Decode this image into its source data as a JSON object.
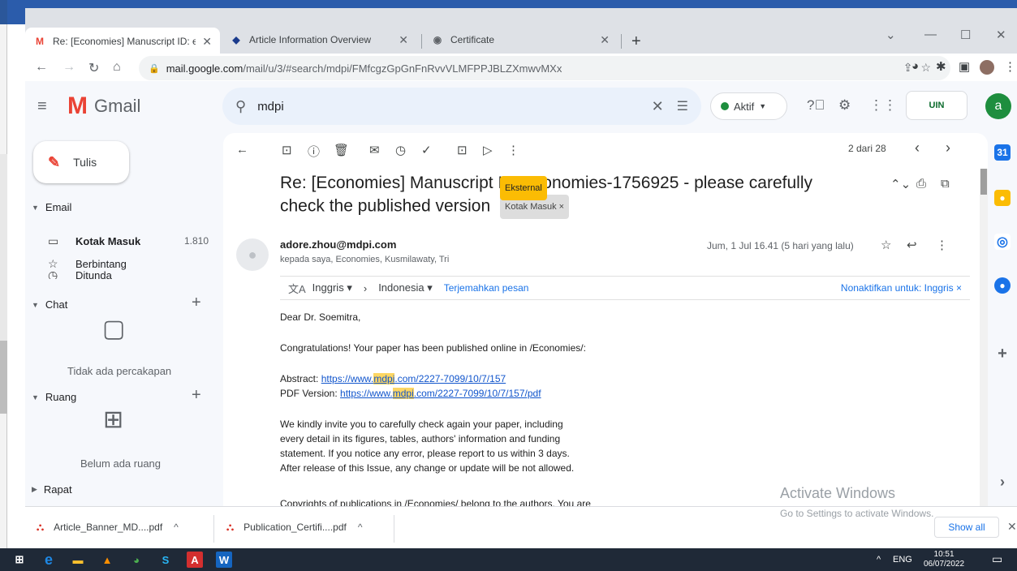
{
  "tabs": [
    {
      "label": "Re: [Economies] Manuscript ID: e",
      "active": true
    },
    {
      "label": "Article Information Overview",
      "active": false
    },
    {
      "label": "Certificate",
      "active": false
    }
  ],
  "address": {
    "host": "mail.google.com",
    "path": "/mail/u/3/#search/mdpi/FMfcgzGpGnFnRvvVLMFPPJBLZXmwvMXx"
  },
  "gmail": {
    "logo_text": "Gmail",
    "search_value": "mdpi",
    "status": "Aktif",
    "avatar_letter": "a",
    "org_badge": "UIN"
  },
  "sidebar": {
    "compose": "Tulis",
    "email_section": "Email",
    "items": [
      {
        "label": "Kotak Masuk",
        "count": "1.810"
      },
      {
        "label": "Berbintang",
        "count": ""
      },
      {
        "label": "Ditunda",
        "count": ""
      }
    ],
    "chat_section": "Chat",
    "chat_empty": "Tidak ada percakapan",
    "spaces_section": "Ruang",
    "spaces_empty": "Belum ada ruang",
    "meet_section": "Rapat"
  },
  "message": {
    "pager": "2 dari 28",
    "subject_line1": "Re: [Economies] Manuscript ID: economies-1756925 - please carefully",
    "subject_line2": "check the published version",
    "badge_external": "Eksternal",
    "badge_inbox": "Kotak Masuk",
    "sender": "adore.zhou@mdpi.com",
    "recipients": "kepada saya, Economies, Kusmilawaty, Tri",
    "date": "Jum, 1 Jul 16.41 (5 hari yang lalu)",
    "translate": {
      "from": "Inggris",
      "to": "Indonesia",
      "action": "Terjemahkan pesan",
      "disable": "Nonaktifkan untuk: Inggris"
    },
    "greeting": "Dear Dr. Soemitra,",
    "congrats": "Congratulations! Your paper has been published online in /Economies/:",
    "abstract_label": "Abstract:",
    "abstract_url_pre": "https://www.",
    "abstract_url_hl": "mdpi",
    "abstract_url_post": ".com/2227-7099/10/7/157",
    "pdf_label": "PDF Version:",
    "pdf_url_pre": "https://www.",
    "pdf_url_hl": "mdpi",
    "pdf_url_post": ".com/2227-7099/10/7/157/pdf",
    "para1_l1": "We kindly invite you to carefully check again your paper, including",
    "para1_l2": "every detail in its figures, tables, authors' information and funding",
    "para1_l3": "statement. If you notice any error, please report to us within 3 days.",
    "para1_l4": "After release of this Issue, any change or update will be not allowed.",
    "para2_l1": "Copyrights of publications in /Economies/ belong to the authors. You are"
  },
  "watermark": {
    "title": "Activate Windows",
    "subtitle": "Go to Settings to activate Windows."
  },
  "downloads": [
    {
      "name": "Article_Banner_MD....pdf"
    },
    {
      "name": "Publication_Certifi....pdf"
    }
  ],
  "show_all": "Show all",
  "taskbar": {
    "lang": "ENG",
    "time": "10:51",
    "date": "06/07/2022"
  }
}
